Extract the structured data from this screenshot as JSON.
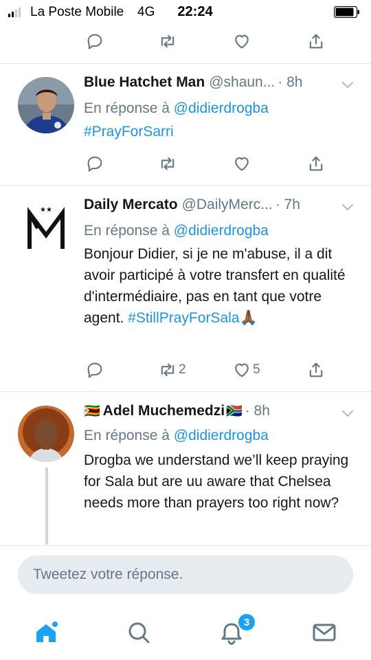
{
  "status_bar": {
    "carrier": "La Poste Mobile",
    "network": "4G",
    "time": "22:24"
  },
  "colors": {
    "accent": "#1da1f2",
    "link": "#1b95e0",
    "muted": "#657786",
    "divider": "#e1e8ed"
  },
  "tweets": [
    {
      "name": "Blue Hatchet Man",
      "handle": "@shaun...",
      "time": "· 8h",
      "reply_prefix": "En réponse à",
      "reply_to": "@didierdrogba",
      "hashtag": "#PrayForSarri",
      "text": "",
      "retweets": "",
      "likes": ""
    },
    {
      "name": "Daily Mercato",
      "handle": "@DailyMerc...",
      "time": "· 7h",
      "reply_prefix": "En réponse à",
      "reply_to": "@didierdrogba",
      "text": "Bonjour Didier, si je ne m'abuse, il a dit avoir participé à votre transfert en qualité d'intermédiaire, pas en tant que votre agent.",
      "hashtag": "#StillPrayForSala",
      "emoji": "🙏🏾",
      "retweets": "2",
      "likes": "5"
    },
    {
      "name_prefix_flag": "🇿🇼",
      "name": "Adel Muchemedzi",
      "name_suffix_flag": "🇿🇦",
      "handle": "",
      "time": "· 8h",
      "reply_prefix": "En réponse à",
      "reply_to": "@didierdrogba",
      "text": "Drogba we understand we’ll keep praying for Sala but are uu aware that Chelsea needs more than prayers too right now?"
    }
  ],
  "composer": {
    "placeholder": "Tweetez votre réponse."
  },
  "nav": {
    "items": [
      "home-icon",
      "search-icon",
      "notifications-icon",
      "messages-icon"
    ],
    "notification_count": "3"
  }
}
